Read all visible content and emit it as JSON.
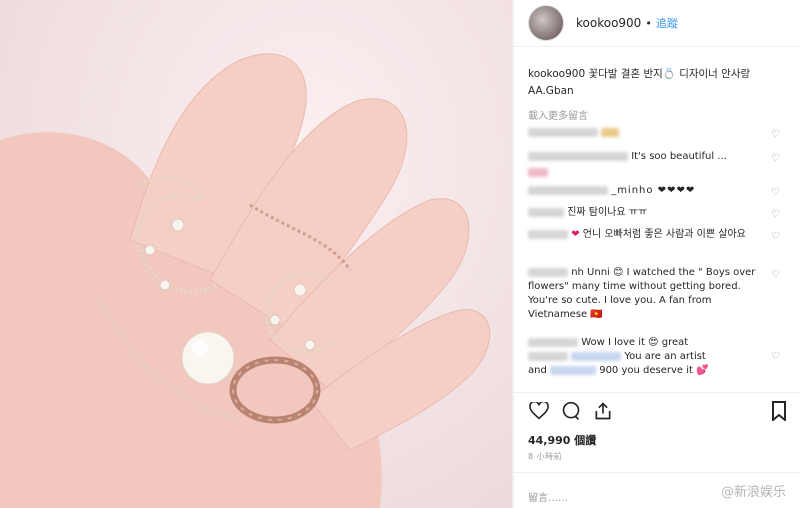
{
  "post": {
    "username": "kookoo900",
    "follow_label": "追蹤",
    "caption": "kookoo900 꽃다발 결혼 반지💍 디자이너 안사랑 AA.Gban",
    "load_more": "載入更多留言"
  },
  "comments": [
    {
      "text": ""
    },
    {
      "text": "It's soo beautiful ..."
    },
    {
      "text": ""
    },
    {
      "text": "_minho ❤❤❤❤"
    },
    {
      "text": "진짜 탐이나요 ㅠㅠ"
    },
    {
      "text": "언니 오빠처럼 좋은 사람과 이쁜 살아요"
    },
    {
      "text": "nh Unni 😊 I watched the \" Boys over flowers\" many time without getting bored. You're so cute. I love you. A fan from Vietnamese 🇻🇳"
    },
    {
      "text": "Wow I love it 😍 great"
    },
    {
      "text": "You are an artist"
    },
    {
      "text": "and"
    },
    {
      "text": "900 you deserve it 💕"
    }
  ],
  "likes": "44,990 個讚",
  "time": "8 小時前",
  "add_comment": "留言……",
  "watermark": "@新浪娱乐",
  "icons": [
    "heart-icon",
    "comment-icon",
    "share-icon",
    "bookmark-icon"
  ]
}
